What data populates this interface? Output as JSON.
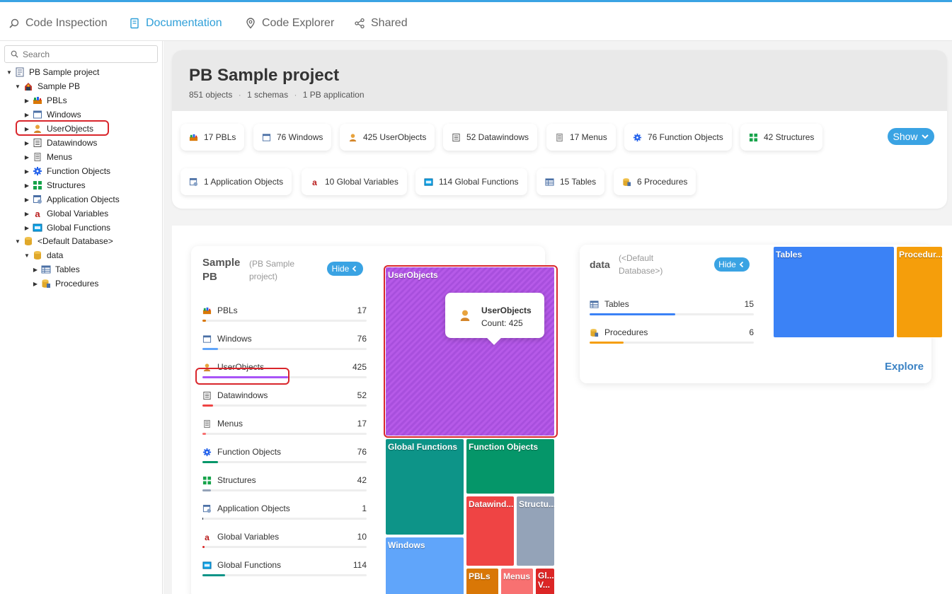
{
  "nav": {
    "tabs": [
      {
        "label": "Code Inspection"
      },
      {
        "label": "Documentation"
      },
      {
        "label": "Code Explorer"
      },
      {
        "label": "Shared"
      }
    ],
    "active": "Documentation",
    "accent": "#2f9fd8"
  },
  "sidebar": {
    "search_placeholder": "Search",
    "tree": [
      {
        "label": "PB Sample project",
        "icon": "project-icon"
      },
      {
        "label": "Sample PB",
        "icon": "application-icon"
      },
      {
        "label": "PBLs",
        "icon": "pbl-icon"
      },
      {
        "label": "Windows",
        "icon": "window-icon"
      },
      {
        "label": "UserObjects",
        "icon": "userobject-icon"
      },
      {
        "label": "Datawindows",
        "icon": "datawindow-icon"
      },
      {
        "label": "Menus",
        "icon": "menu-icon"
      },
      {
        "label": "Function Objects",
        "icon": "gear-icon"
      },
      {
        "label": "Structures",
        "icon": "structure-icon"
      },
      {
        "label": "Application Objects",
        "icon": "application-object-icon"
      },
      {
        "label": "Global Variables",
        "icon": "global-variable-icon"
      },
      {
        "label": "Global Functions",
        "icon": "global-function-icon"
      },
      {
        "label": "<Default Database>",
        "icon": "database-icon"
      },
      {
        "label": "data",
        "icon": "database-icon"
      },
      {
        "label": "Tables",
        "icon": "table-icon"
      },
      {
        "label": "Procedures",
        "icon": "procedure-icon"
      }
    ]
  },
  "project": {
    "title": "PB Sample project",
    "stats": [
      "851 objects",
      "1 schemas",
      "1 PB application"
    ],
    "separator": "·",
    "chips": [
      {
        "label": "17 PBLs",
        "icon": "pbl-icon"
      },
      {
        "label": "76 Windows",
        "icon": "window-icon"
      },
      {
        "label": "425 UserObjects",
        "icon": "userobject-icon"
      },
      {
        "label": "52 Datawindows",
        "icon": "datawindow-icon"
      },
      {
        "label": "17 Menus",
        "icon": "menu-icon"
      },
      {
        "label": "76 Function Objects",
        "icon": "gear-icon"
      },
      {
        "label": "42 Structures",
        "icon": "structure-icon"
      },
      {
        "label": "1 Application Objects",
        "icon": "application-object-icon"
      },
      {
        "label": "10 Global Variables",
        "icon": "global-variable-icon"
      },
      {
        "label": "114 Global Functions",
        "icon": "global-function-icon"
      },
      {
        "label": "15 Tables",
        "icon": "table-icon"
      },
      {
        "label": "6 Procedures",
        "icon": "procedure-icon"
      }
    ],
    "show_label": "Show"
  },
  "pb_card": {
    "name": "Sample PB",
    "parent": "(PB Sample project)",
    "hide_label": "Hide",
    "max": 425,
    "rows": [
      {
        "label": "PBLs",
        "value": 17,
        "color": "#d97706",
        "icon": "pbl-icon"
      },
      {
        "label": "Windows",
        "value": 76,
        "color": "#60a5fa",
        "icon": "window-icon"
      },
      {
        "label": "UserObjects",
        "value": 425,
        "color": "#a855f7",
        "icon": "userobject-icon"
      },
      {
        "label": "Datawindows",
        "value": 52,
        "color": "#ef4444",
        "icon": "datawindow-icon"
      },
      {
        "label": "Menus",
        "value": 17,
        "color": "#f87171",
        "icon": "menu-icon"
      },
      {
        "label": "Function Objects",
        "value": 76,
        "color": "#059669",
        "icon": "gear-icon"
      },
      {
        "label": "Structures",
        "value": 42,
        "color": "#94a3b8",
        "icon": "structure-icon"
      },
      {
        "label": "Application Objects",
        "value": 1,
        "color": "#1f2937",
        "icon": "application-object-icon"
      },
      {
        "label": "Global Variables",
        "value": 10,
        "color": "#dc2626",
        "icon": "global-variable-icon"
      },
      {
        "label": "Global Functions",
        "value": 114,
        "color": "#0d9488",
        "icon": "global-function-icon"
      }
    ]
  },
  "treemap": {
    "cells": [
      {
        "label": "UserObjects",
        "color": "#a855f7"
      },
      {
        "label": "Global Functions",
        "color": "#0d9488"
      },
      {
        "label": "Function Objects",
        "color": "#059669"
      },
      {
        "label": "Datawind...",
        "color": "#ef4444"
      },
      {
        "label": "Structu...",
        "color": "#94a3b8"
      },
      {
        "label": "Windows",
        "color": "#60a5fa"
      },
      {
        "label": "PBLs",
        "color": "#d97706"
      },
      {
        "label": "Menus",
        "color": "#f87171"
      },
      {
        "label": "Gl... V...",
        "color": "#dc2626"
      }
    ],
    "tooltip": {
      "title": "UserObjects",
      "count": "Count: 425"
    }
  },
  "data_card": {
    "name": "data",
    "parent": "(<Default Database>)",
    "hide_label": "Hide",
    "max": 15,
    "rows": [
      {
        "label": "Tables",
        "value": 15,
        "color": "#3b82f6",
        "icon": "table-icon"
      },
      {
        "label": "Procedures",
        "value": 6,
        "color": "#f59e0b",
        "icon": "procedure-icon"
      }
    ],
    "explore_label": "Explore",
    "cells": [
      {
        "label": "Tables",
        "color": "#3b82f6"
      },
      {
        "label": "Procedur...",
        "color": "#f59e0b"
      }
    ]
  }
}
